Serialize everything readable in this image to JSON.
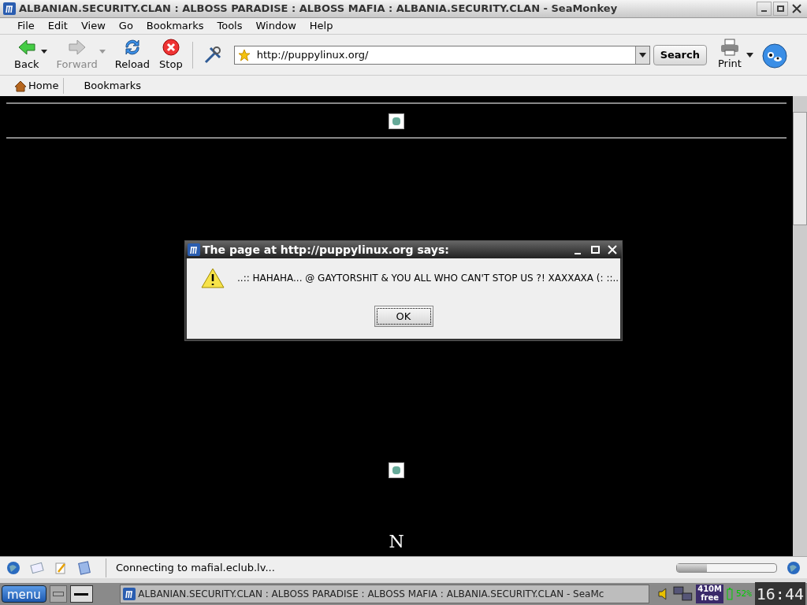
{
  "window": {
    "title": "ALBANIAN.SECURITY.CLAN : ALBOSS PARADISE : ALBOSS MAFIA : ALBANIA.SECURITY.CLAN - SeaMonkey"
  },
  "menu": [
    "File",
    "Edit",
    "View",
    "Go",
    "Bookmarks",
    "Tools",
    "Window",
    "Help"
  ],
  "toolbar": [
    {
      "label": "Back",
      "kind": "back",
      "disabled": false
    },
    {
      "label": "Forward",
      "kind": "forward",
      "disabled": true
    },
    {
      "label": "Reload",
      "kind": "reload",
      "disabled": false
    },
    {
      "label": "Stop",
      "kind": "stop",
      "disabled": false
    }
  ],
  "address": {
    "value": "http://puppylinux.org/"
  },
  "search_button": "Search",
  "print_button": "Print",
  "bookmarks_bar": {
    "home": "Home",
    "bookmarks": "Bookmarks"
  },
  "page": {
    "letter": "N"
  },
  "dialog": {
    "title": "The page at http://puppylinux.org says:",
    "message": "..:: HAHAHA... @ GAYTORSHIT & YOU ALL WHO CAN'T STOP US ?! XAXXAXA (: ::..",
    "button": "OK"
  },
  "status_bar": {
    "text": "Connecting to mafial.eclub.lv...",
    "level": 0.3
  },
  "taskbar": {
    "menu": "menu",
    "task": "ALBANIAN.SECURITY.CLAN : ALBOSS PARADISE : ALBOSS MAFIA : ALBANIA.SECURITY.CLAN - SeaMc",
    "memory": "410M",
    "memory_label": "free",
    "battery": "52%",
    "clock": "16:44"
  }
}
